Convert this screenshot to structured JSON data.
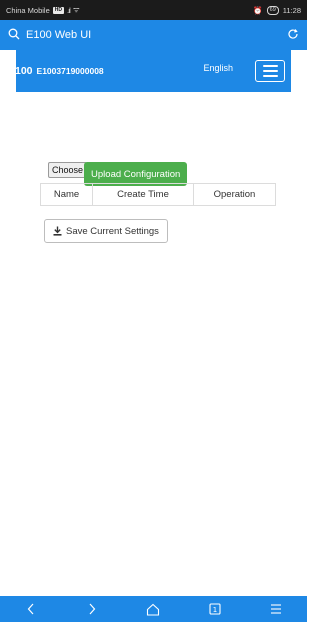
{
  "status_bar": {
    "carrier": "China Mobile",
    "network_badge": "HD",
    "signal": ".ıl",
    "wifi": "ᯤ",
    "alarm": "⏰",
    "battery": "69",
    "time": "11:28"
  },
  "address_bar": {
    "search_icon": "search-icon",
    "url": "E100 Web UI",
    "reload_icon": "reload-icon"
  },
  "header": {
    "brand": "E100",
    "serial": "E1003719000008",
    "language": "English",
    "menu_icon": "hamburger-icon"
  },
  "upload": {
    "choose_label": "Choose",
    "upload_label": "Upload Configuration"
  },
  "table": {
    "columns": [
      "Name",
      "Create Time",
      "Operation"
    ]
  },
  "save": {
    "label": "Save Current Settings",
    "icon": "download-icon"
  },
  "nav": {
    "back": "<",
    "forward": ">"
  },
  "colors": {
    "primary": "#1e88e5",
    "success": "#4cae4c",
    "status_bar": "#1b1b1b"
  }
}
